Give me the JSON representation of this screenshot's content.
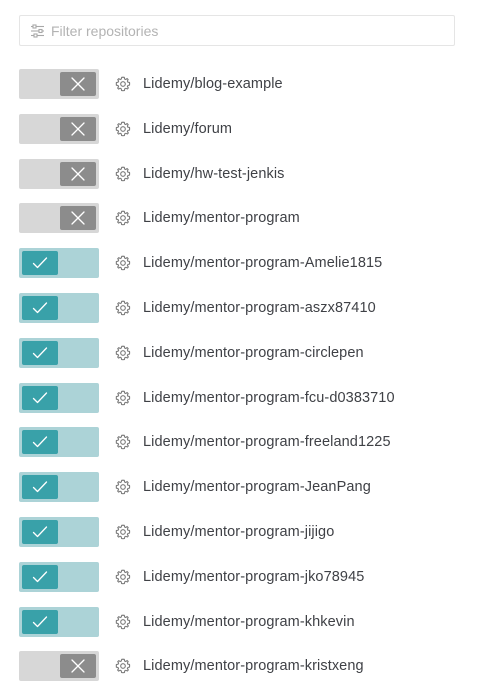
{
  "filter": {
    "placeholder": "Filter repositories",
    "icon": "sliders-icon"
  },
  "colors": {
    "toggle_off_track": "#d7d7d7",
    "toggle_off_knob": "#8c8c8c",
    "toggle_on_track": "#acd3d7",
    "toggle_on_knob": "#39a1a9",
    "text": "#3f4146",
    "placeholder": "#b3b3b3"
  },
  "repositories": [
    {
      "name": "Lidemy/blog-example",
      "enabled": false
    },
    {
      "name": "Lidemy/forum",
      "enabled": false
    },
    {
      "name": "Lidemy/hw-test-jenkis",
      "enabled": false
    },
    {
      "name": "Lidemy/mentor-program",
      "enabled": false
    },
    {
      "name": "Lidemy/mentor-program-Amelie1815",
      "enabled": true
    },
    {
      "name": "Lidemy/mentor-program-aszx87410",
      "enabled": true
    },
    {
      "name": "Lidemy/mentor-program-circlepen",
      "enabled": true
    },
    {
      "name": "Lidemy/mentor-program-fcu-d0383710",
      "enabled": true
    },
    {
      "name": "Lidemy/mentor-program-freeland1225",
      "enabled": true
    },
    {
      "name": "Lidemy/mentor-program-JeanPang",
      "enabled": true
    },
    {
      "name": "Lidemy/mentor-program-jijigo",
      "enabled": true
    },
    {
      "name": "Lidemy/mentor-program-jko78945",
      "enabled": true
    },
    {
      "name": "Lidemy/mentor-program-khkevin",
      "enabled": true
    },
    {
      "name": "Lidemy/mentor-program-kristxeng",
      "enabled": false
    }
  ]
}
